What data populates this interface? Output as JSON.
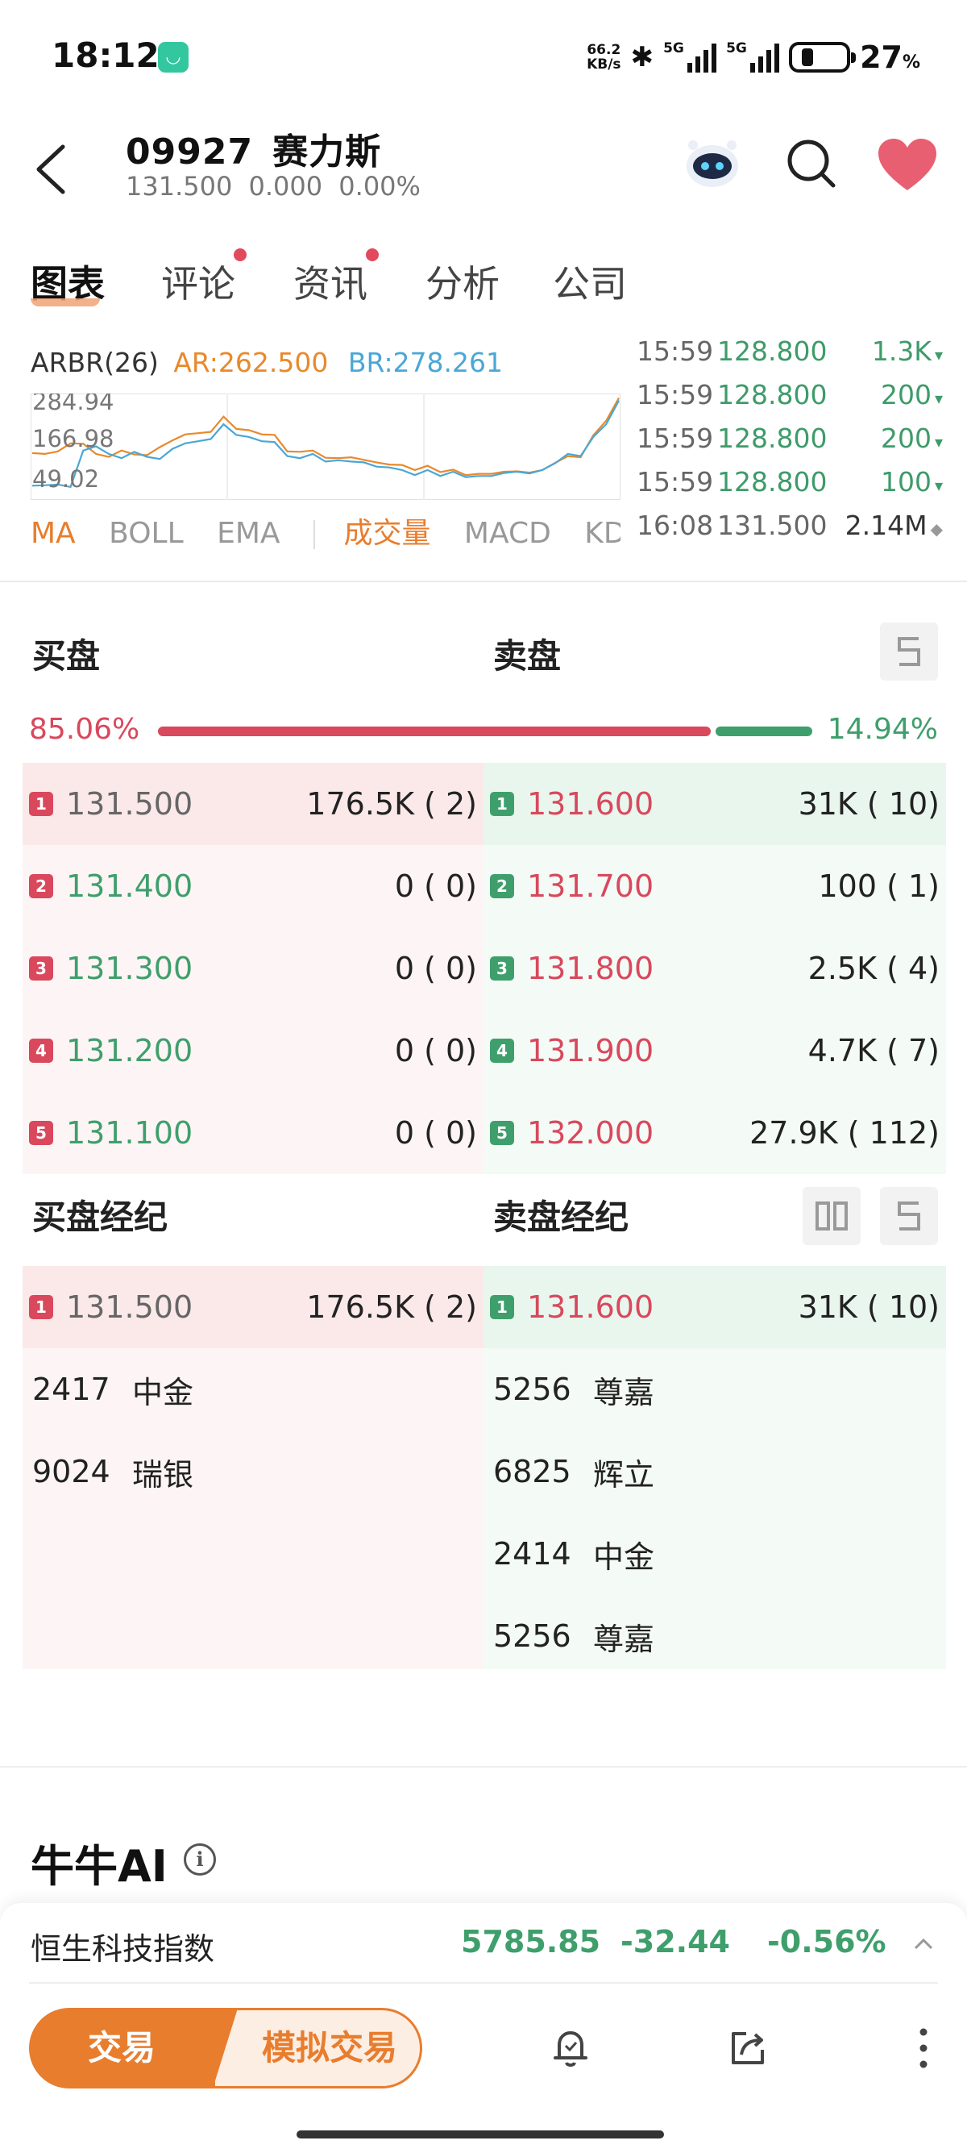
{
  "status_bar": {
    "time": "18:12",
    "net_speed_value": "66.2",
    "net_speed_unit": "KB/s",
    "sim1": "5G",
    "sim2": "5G",
    "battery_pct": "27",
    "battery_unit": "%"
  },
  "header": {
    "code": "09927",
    "name": "赛力斯",
    "price": "131.500",
    "change": "0.000",
    "change_pct": "0.00%"
  },
  "tabs": [
    {
      "label": "图表",
      "active": true,
      "dot": false
    },
    {
      "label": "评论",
      "active": false,
      "dot": true
    },
    {
      "label": "资讯",
      "active": false,
      "dot": true
    },
    {
      "label": "分析",
      "active": false,
      "dot": false
    },
    {
      "label": "公司",
      "active": false,
      "dot": false
    }
  ],
  "indicator": {
    "name": "ARBR(26)",
    "ar": "AR:262.500",
    "br": "BR:278.261"
  },
  "chart_data": {
    "type": "line",
    "y_ticks": [
      "284.94",
      "166.98",
      "49.02"
    ],
    "ylim": [
      49.02,
      284.94
    ],
    "series": [
      {
        "name": "AR",
        "color": "#e8892c",
        "values": [
          152,
          150,
          156,
          175,
          174,
          150,
          143,
          158,
          149,
          147,
          166,
          182,
          196,
          199,
          202,
          238,
          209,
          206,
          196,
          195,
          156,
          155,
          158,
          141,
          140,
          142,
          136,
          130,
          125,
          124,
          112,
          122,
          107,
          113,
          100,
          103,
          103,
          108,
          109,
          106,
          112,
          129,
          145,
          142,
          194,
          228,
          282
        ]
      },
      {
        "name": "BR",
        "color": "#4aa7d6",
        "values": [
          75,
          76,
          78,
          72,
          158,
          168,
          150,
          140,
          155,
          143,
          138,
          162,
          175,
          180,
          185,
          220,
          195,
          190,
          180,
          178,
          145,
          140,
          150,
          132,
          135,
          132,
          130,
          120,
          118,
          112,
          100,
          112,
          98,
          108,
          95,
          98,
          98,
          105,
          108,
          104,
          112,
          128,
          150,
          145,
          190,
          220,
          276
        ]
      }
    ]
  },
  "chart_tabs": [
    "MA",
    "BOLL",
    "EMA",
    "成交量",
    "MACD",
    "KD"
  ],
  "ticks": [
    {
      "time": "15:59",
      "price": "128.800",
      "vol": "1.3K",
      "dir": "▾"
    },
    {
      "time": "15:59",
      "price": "128.800",
      "vol": "200",
      "dir": "▾"
    },
    {
      "time": "15:59",
      "price": "128.800",
      "vol": "200",
      "dir": "▾"
    },
    {
      "time": "15:59",
      "price": "128.800",
      "vol": "100",
      "dir": "▾"
    },
    {
      "time": "16:08",
      "price": "131.500",
      "vol": "2.14M",
      "dir": "◆"
    }
  ],
  "orderbook": {
    "buy_label": "买盘",
    "sell_label": "卖盘",
    "buy_pct": "85.06%",
    "sell_pct": "14.94%",
    "buy_ratio": 85.06,
    "bids": [
      {
        "lvl": "1",
        "price": "131.500",
        "vol": "176.5K ( 2)",
        "color": "gray"
      },
      {
        "lvl": "2",
        "price": "131.400",
        "vol": "0 ( 0)",
        "color": "green"
      },
      {
        "lvl": "3",
        "price": "131.300",
        "vol": "0 ( 0)",
        "color": "green"
      },
      {
        "lvl": "4",
        "price": "131.200",
        "vol": "0 ( 0)",
        "color": "green"
      },
      {
        "lvl": "5",
        "price": "131.100",
        "vol": "0 ( 0)",
        "color": "green"
      }
    ],
    "asks": [
      {
        "lvl": "1",
        "price": "131.600",
        "vol": "31K ( 10)",
        "color": "red"
      },
      {
        "lvl": "2",
        "price": "131.700",
        "vol": "100 ( 1)",
        "color": "red"
      },
      {
        "lvl": "3",
        "price": "131.800",
        "vol": "2.5K ( 4)",
        "color": "red"
      },
      {
        "lvl": "4",
        "price": "131.900",
        "vol": "4.7K ( 7)",
        "color": "red"
      },
      {
        "lvl": "5",
        "price": "132.000",
        "vol": "27.9K ( 112)",
        "color": "red"
      }
    ]
  },
  "brokers": {
    "buy_label": "买盘经纪",
    "sell_label": "卖盘经纪",
    "buy_top": {
      "lvl": "1",
      "price": "131.500",
      "vol": "176.5K ( 2)"
    },
    "sell_top": {
      "lvl": "1",
      "price": "131.600",
      "vol": "31K ( 10)"
    },
    "buy_list": [
      {
        "code": "2417",
        "name": "中金"
      },
      {
        "code": "9024",
        "name": "瑞银"
      }
    ],
    "sell_list": [
      {
        "code": "5256",
        "name": "尊嘉"
      },
      {
        "code": "6825",
        "name": "辉立"
      },
      {
        "code": "2414",
        "name": "中金"
      },
      {
        "code": "5256",
        "name": "尊嘉"
      }
    ]
  },
  "ai": {
    "title": "牛牛AI",
    "info": "i"
  },
  "index_strip": {
    "name": "恒生科技指数",
    "value": "5785.85",
    "change": "-32.44",
    "change_pct": "-0.56%"
  },
  "toolbar": {
    "trade": "交易",
    "sim_trade": "模拟交易"
  },
  "colors": {
    "accent": "#e87d2e",
    "up_red": "#d9485c",
    "down_green": "#3f9f6c"
  }
}
